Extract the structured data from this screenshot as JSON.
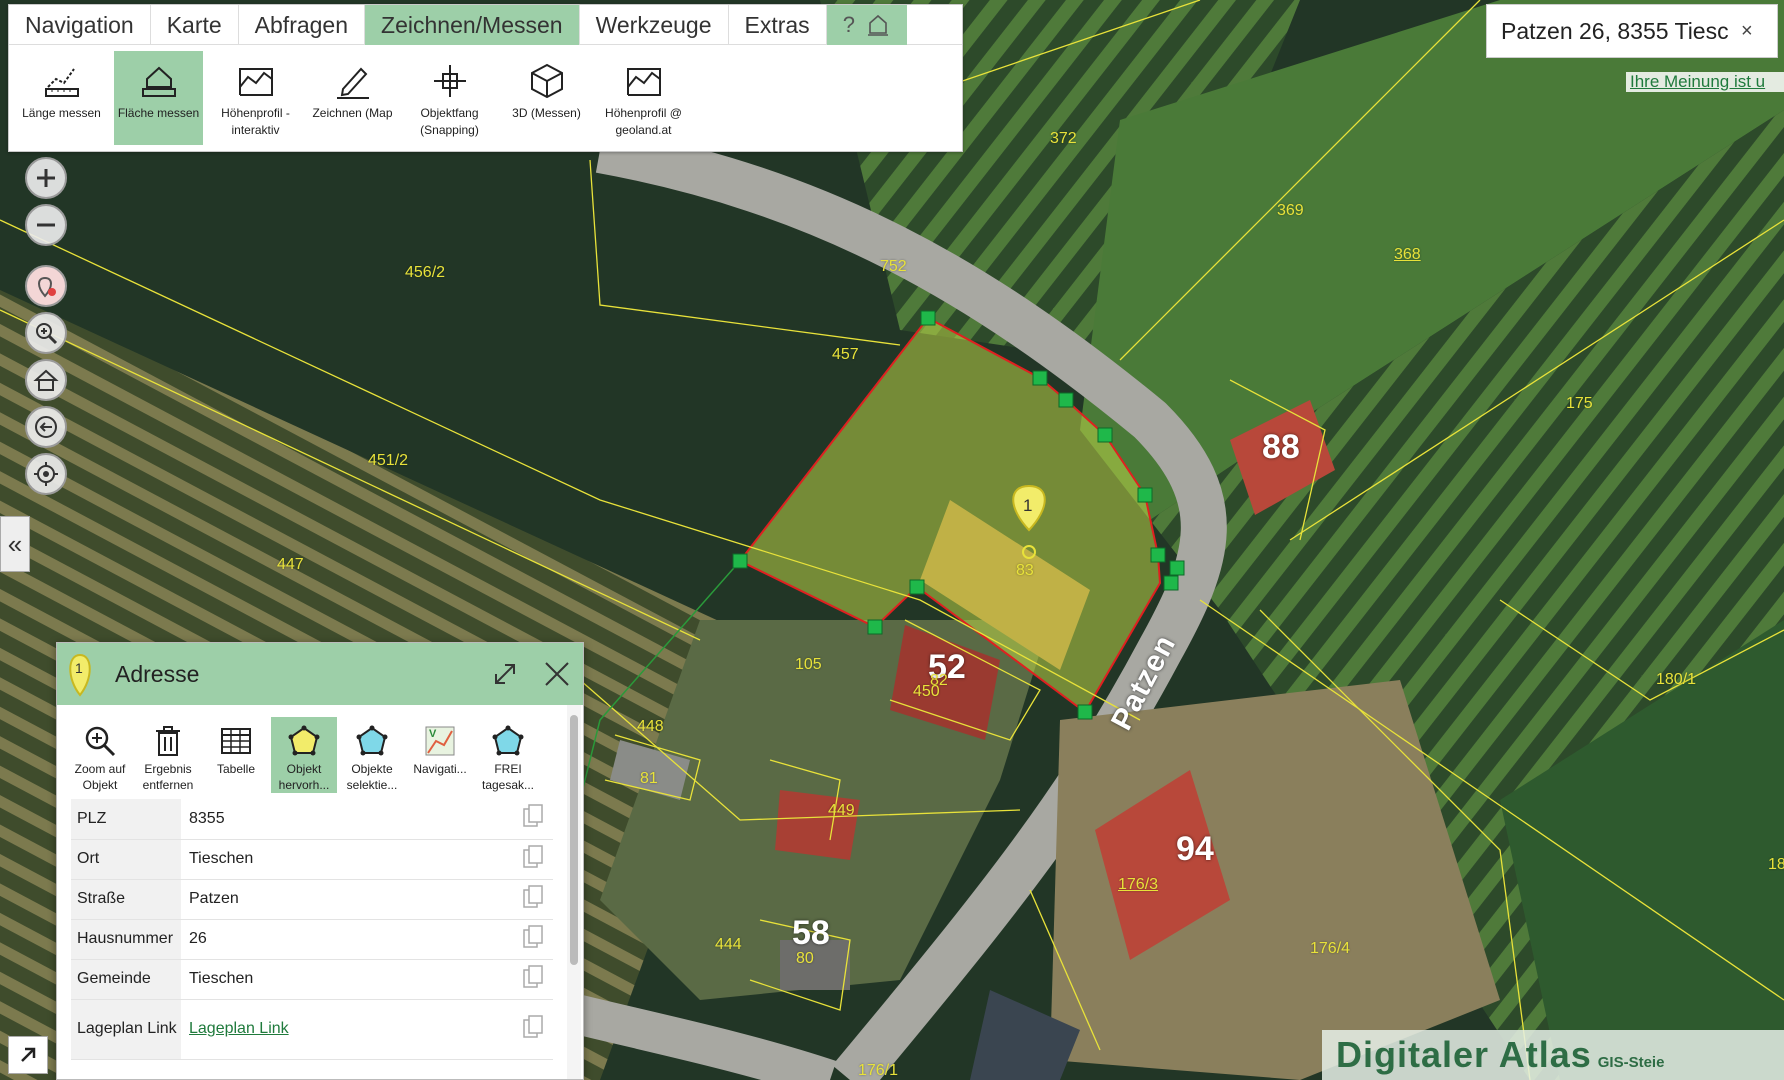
{
  "menu": {
    "tabs": [
      {
        "label": "Navigation"
      },
      {
        "label": "Karte"
      },
      {
        "label": "Abfragen"
      },
      {
        "label": "Zeichnen/Messen"
      },
      {
        "label": "Werkzeuge"
      },
      {
        "label": "Extras"
      }
    ],
    "help_label": "?",
    "tools": [
      {
        "label": "Länge messen",
        "icon": "ruler-length-icon"
      },
      {
        "label": "Fläche messen",
        "icon": "area-measure-icon"
      },
      {
        "label": "Höhenprofil - interaktiv",
        "icon": "elevation-profile-icon"
      },
      {
        "label": "Zeichnen (Map",
        "icon": "pencil-draw-icon"
      },
      {
        "label": "Objektfang (Snapping)",
        "icon": "snapping-crosshair-icon"
      },
      {
        "label": "3D (Messen)",
        "icon": "cube-3d-icon"
      },
      {
        "label": "Höhenprofil @ geoland.at",
        "icon": "elevation-profile-geoland-icon"
      }
    ]
  },
  "search": {
    "value": "Patzen 26, 8355 Tiesc",
    "clear": "×"
  },
  "feedback_link": "Ihre Meinung ist u",
  "collapse_label": "«",
  "map": {
    "parcels": [
      "372",
      "369",
      "368",
      "752",
      "456/2",
      "457",
      "175",
      "451/2",
      "88",
      "447",
      "1",
      "83",
      "180/1",
      "105",
      "52",
      "82",
      "450",
      "448",
      "81",
      "449",
      "94",
      "176/3",
      "176/4",
      "444",
      "58",
      "80",
      "176/1",
      "18"
    ],
    "street": "Patzen"
  },
  "panel": {
    "marker": "1",
    "title": "Adresse",
    "tools": [
      {
        "label": "Zoom auf Objekt"
      },
      {
        "label": "Ergebnis entfernen"
      },
      {
        "label": "Tabelle"
      },
      {
        "label": "Objekt hervorh..."
      },
      {
        "label": "Objekte selektie..."
      },
      {
        "label": "Navigati..."
      },
      {
        "label": "FREI tagesak..."
      }
    ],
    "rows": [
      {
        "key": "PLZ",
        "value": "8355"
      },
      {
        "key": "Ort",
        "value": "Tieschen"
      },
      {
        "key": "Straße",
        "value": "Patzen"
      },
      {
        "key": "Hausnummer",
        "value": "26"
      },
      {
        "key": "Gemeinde",
        "value": "Tieschen"
      },
      {
        "key": "Lageplan Link",
        "value": "Lageplan Link"
      }
    ]
  },
  "logo": {
    "main": "Digitaler Atlas",
    "sub": "GIS-Steie"
  }
}
